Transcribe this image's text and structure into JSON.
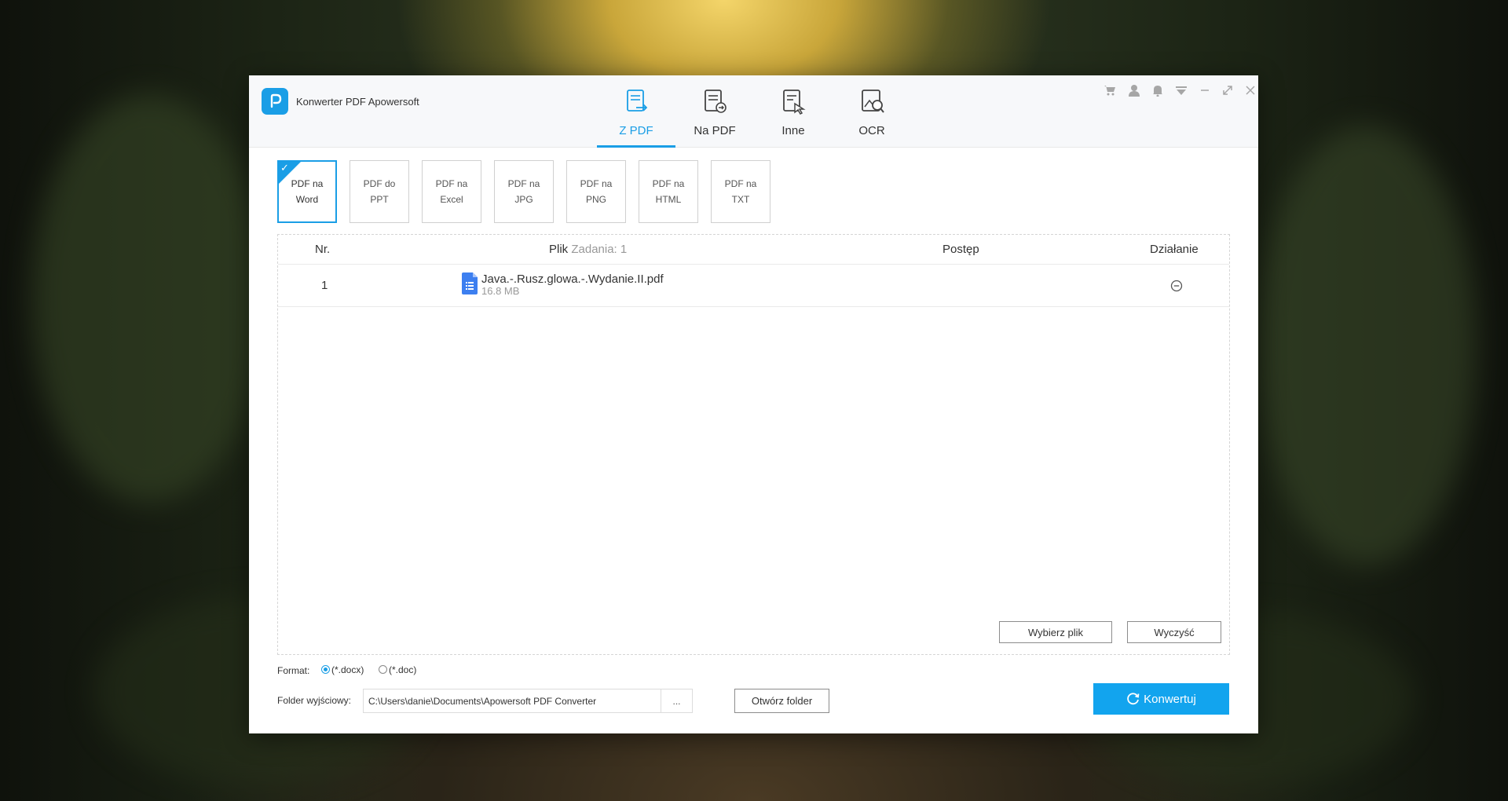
{
  "app": {
    "title": "Konwerter PDF Apowersoft"
  },
  "nav_tabs": [
    {
      "label": "Z PDF",
      "icon": "from-pdf-icon",
      "active": true
    },
    {
      "label": "Na PDF",
      "icon": "to-pdf-icon",
      "active": false
    },
    {
      "label": "Inne",
      "icon": "other-tools-icon",
      "active": false
    },
    {
      "label": "OCR",
      "icon": "ocr-icon",
      "active": false
    }
  ],
  "window_controls": [
    "cart-icon",
    "user-icon",
    "bell-icon",
    "menu-dropdown-icon",
    "minimize-icon",
    "maximize-icon",
    "close-icon"
  ],
  "conversions": [
    {
      "label": "PDF na Word",
      "active": true
    },
    {
      "label": "PDF do PPT",
      "active": false
    },
    {
      "label": "PDF na Excel",
      "active": false
    },
    {
      "label": "PDF na JPG",
      "active": false
    },
    {
      "label": "PDF na PNG",
      "active": false
    },
    {
      "label": "PDF na HTML",
      "active": false
    },
    {
      "label": "PDF na TXT",
      "active": false
    }
  ],
  "table": {
    "col_nr": "Nr.",
    "col_file": "Plik",
    "tasks_label": "Zadania: 1",
    "col_progress": "Postęp",
    "col_action": "Działanie",
    "rows": [
      {
        "nr": "1",
        "file_name": "Java.-.Rusz.glowa.-.Wydanie.II.pdf",
        "file_size": "16.8 MB"
      }
    ]
  },
  "buttons": {
    "choose_file": "Wybierz plik",
    "clear": "Wyczyść",
    "open_folder": "Otwórz folder",
    "convert": "Konwertuj",
    "browse": "..."
  },
  "format": {
    "label": "Format:",
    "options": [
      {
        "label": "(*.docx)",
        "checked": true
      },
      {
        "label": "(*.doc)",
        "checked": false
      }
    ]
  },
  "output": {
    "label": "Folder wyjściowy:",
    "path": "C:\\Users\\danie\\Documents\\Apowersoft PDF Converter"
  },
  "colors": {
    "accent": "#1a9ee6",
    "convert_button": "#12a4ee",
    "file_icon": "#3d7ff0"
  }
}
